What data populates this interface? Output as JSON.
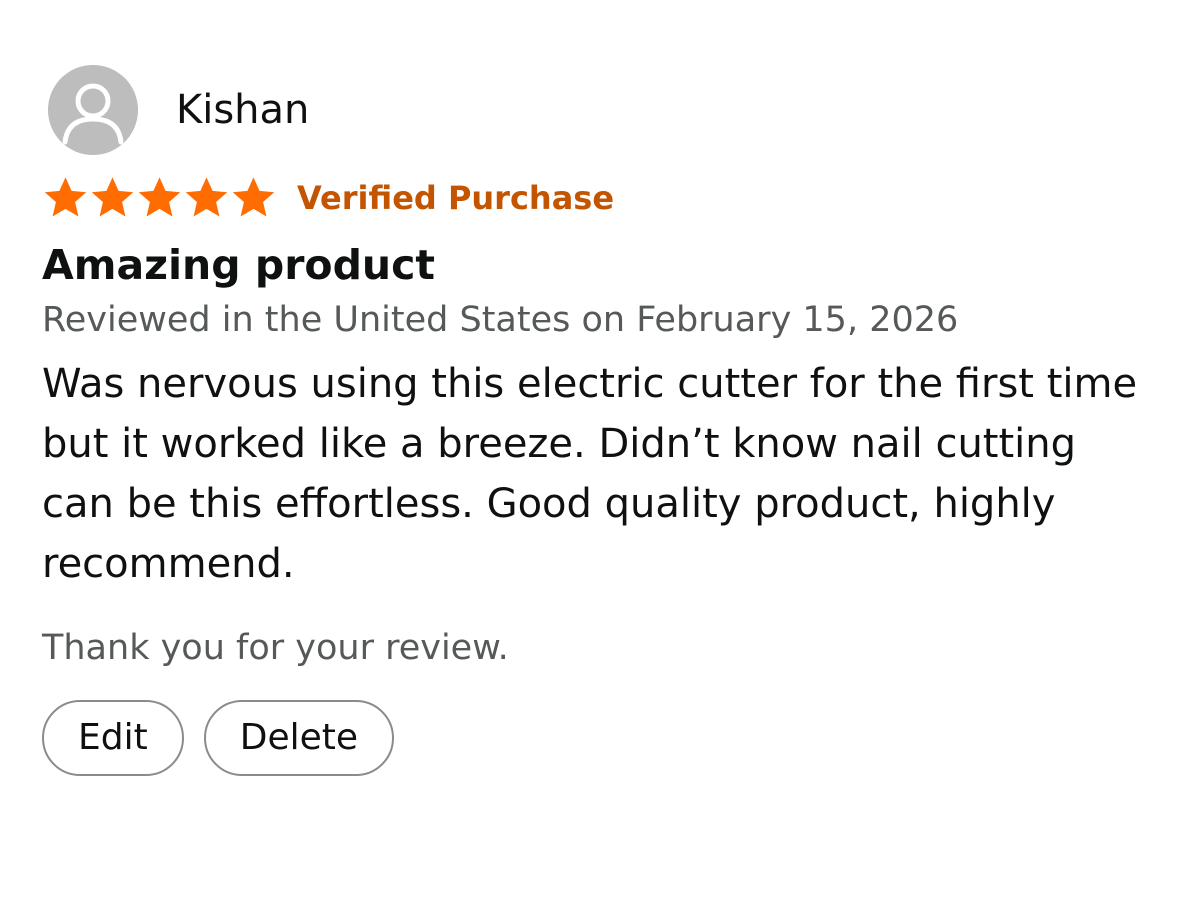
{
  "reviewer": {
    "name": "Kishan",
    "avatar_icon": "default-user-avatar-icon"
  },
  "rating": {
    "stars": 5,
    "max_stars": 5,
    "star_color": "#ff6d00",
    "badge": "Verified Purchase",
    "badge_color": "#c45500"
  },
  "review": {
    "title": "Amazing product",
    "date_line": "Reviewed in the United States on February 15, 2026",
    "body": "Was nervous using this electric cutter for the first time but it worked like a breeze. Didn’t know nail cutting can be this effortless. Good quality product, highly recommend.",
    "thanks": "Thank you for your review."
  },
  "actions": {
    "edit_label": "Edit",
    "delete_label": "Delete"
  }
}
